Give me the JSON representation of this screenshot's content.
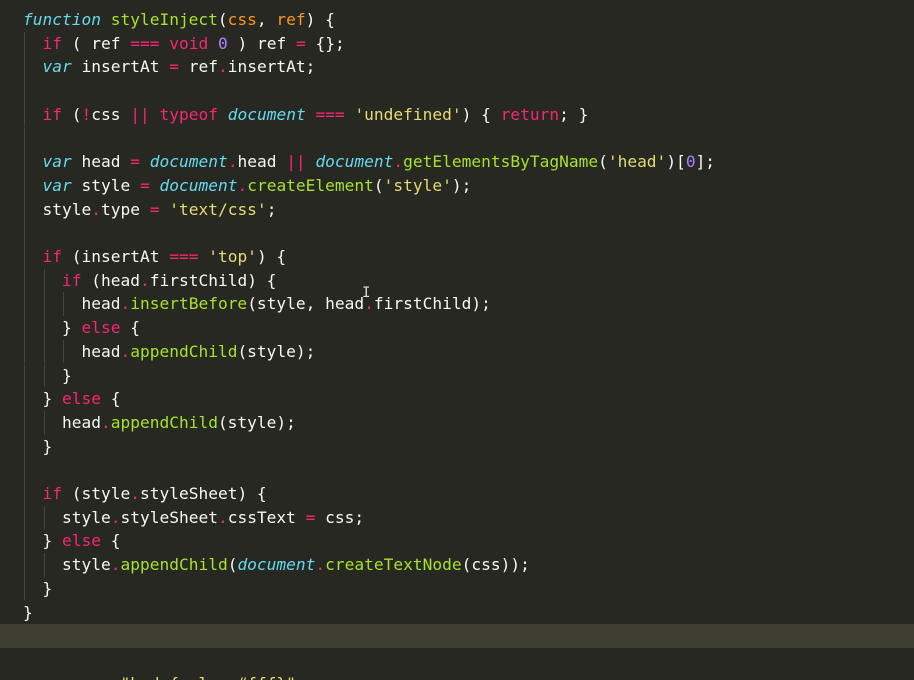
{
  "editor": {
    "language": "javascript",
    "theme": "monokai",
    "colors": {
      "background": "#272822",
      "keyword": "#f92672",
      "storage": "#66d9ef",
      "function": "#a6e22e",
      "parameter": "#fd971f",
      "number": "#ae81ff",
      "string": "#e6db74",
      "text": "#f8f8f2",
      "active_line": "#3e3d32"
    },
    "active_line_index": 26,
    "lines": [
      {
        "indent": 0,
        "tokens": [
          {
            "t": "store",
            "v": "function"
          },
          {
            "t": "plain",
            "v": " "
          },
          {
            "t": "fn",
            "v": "styleInject"
          },
          {
            "t": "plain",
            "v": "("
          },
          {
            "t": "param",
            "v": "css"
          },
          {
            "t": "plain",
            "v": ", "
          },
          {
            "t": "param",
            "v": "ref"
          },
          {
            "t": "plain",
            "v": ") {"
          }
        ]
      },
      {
        "indent": 1,
        "tokens": [
          {
            "t": "kw",
            "v": "if"
          },
          {
            "t": "plain",
            "v": " ( ref "
          },
          {
            "t": "op",
            "v": "==="
          },
          {
            "t": "plain",
            "v": " "
          },
          {
            "t": "kw",
            "v": "void"
          },
          {
            "t": "plain",
            "v": " "
          },
          {
            "t": "num",
            "v": "0"
          },
          {
            "t": "plain",
            "v": " ) ref "
          },
          {
            "t": "op",
            "v": "="
          },
          {
            "t": "plain",
            "v": " {};"
          }
        ]
      },
      {
        "indent": 1,
        "tokens": [
          {
            "t": "store",
            "v": "var"
          },
          {
            "t": "plain",
            "v": " insertAt "
          },
          {
            "t": "op",
            "v": "="
          },
          {
            "t": "plain",
            "v": " ref"
          },
          {
            "t": "op",
            "v": "."
          },
          {
            "t": "plain",
            "v": "insertAt;"
          }
        ]
      },
      {
        "indent": 1,
        "tokens": []
      },
      {
        "indent": 1,
        "tokens": [
          {
            "t": "kw",
            "v": "if"
          },
          {
            "t": "plain",
            "v": " ("
          },
          {
            "t": "op",
            "v": "!"
          },
          {
            "t": "plain",
            "v": "css "
          },
          {
            "t": "op",
            "v": "||"
          },
          {
            "t": "plain",
            "v": " "
          },
          {
            "t": "kw",
            "v": "typeof"
          },
          {
            "t": "plain",
            "v": " "
          },
          {
            "t": "store",
            "v": "document"
          },
          {
            "t": "plain",
            "v": " "
          },
          {
            "t": "op",
            "v": "==="
          },
          {
            "t": "plain",
            "v": " "
          },
          {
            "t": "str",
            "v": "'undefined'"
          },
          {
            "t": "plain",
            "v": ") { "
          },
          {
            "t": "kw",
            "v": "return"
          },
          {
            "t": "plain",
            "v": "; }"
          }
        ]
      },
      {
        "indent": 1,
        "tokens": []
      },
      {
        "indent": 1,
        "tokens": [
          {
            "t": "store",
            "v": "var"
          },
          {
            "t": "plain",
            "v": " head "
          },
          {
            "t": "op",
            "v": "="
          },
          {
            "t": "plain",
            "v": " "
          },
          {
            "t": "store",
            "v": "document"
          },
          {
            "t": "op",
            "v": "."
          },
          {
            "t": "plain",
            "v": "head "
          },
          {
            "t": "op",
            "v": "||"
          },
          {
            "t": "plain",
            "v": " "
          },
          {
            "t": "store",
            "v": "document"
          },
          {
            "t": "op",
            "v": "."
          },
          {
            "t": "fn",
            "v": "getElementsByTagName"
          },
          {
            "t": "plain",
            "v": "("
          },
          {
            "t": "str",
            "v": "'head'"
          },
          {
            "t": "plain",
            "v": ")["
          },
          {
            "t": "num",
            "v": "0"
          },
          {
            "t": "plain",
            "v": "];"
          }
        ]
      },
      {
        "indent": 1,
        "tokens": [
          {
            "t": "store",
            "v": "var"
          },
          {
            "t": "plain",
            "v": " style "
          },
          {
            "t": "op",
            "v": "="
          },
          {
            "t": "plain",
            "v": " "
          },
          {
            "t": "store",
            "v": "document"
          },
          {
            "t": "op",
            "v": "."
          },
          {
            "t": "fn",
            "v": "createElement"
          },
          {
            "t": "plain",
            "v": "("
          },
          {
            "t": "str",
            "v": "'style'"
          },
          {
            "t": "plain",
            "v": ");"
          }
        ]
      },
      {
        "indent": 1,
        "tokens": [
          {
            "t": "plain",
            "v": "style"
          },
          {
            "t": "op",
            "v": "."
          },
          {
            "t": "plain",
            "v": "type "
          },
          {
            "t": "op",
            "v": "="
          },
          {
            "t": "plain",
            "v": " "
          },
          {
            "t": "str",
            "v": "'text/css'"
          },
          {
            "t": "plain",
            "v": ";"
          }
        ]
      },
      {
        "indent": 1,
        "tokens": []
      },
      {
        "indent": 1,
        "tokens": [
          {
            "t": "kw",
            "v": "if"
          },
          {
            "t": "plain",
            "v": " (insertAt "
          },
          {
            "t": "op",
            "v": "==="
          },
          {
            "t": "plain",
            "v": " "
          },
          {
            "t": "str",
            "v": "'top'"
          },
          {
            "t": "plain",
            "v": ") {"
          }
        ]
      },
      {
        "indent": 2,
        "tokens": [
          {
            "t": "kw",
            "v": "if"
          },
          {
            "t": "plain",
            "v": " (head"
          },
          {
            "t": "op",
            "v": "."
          },
          {
            "t": "plain",
            "v": "firstChild) {"
          }
        ]
      },
      {
        "indent": 3,
        "tokens": [
          {
            "t": "plain",
            "v": "head"
          },
          {
            "t": "op",
            "v": "."
          },
          {
            "t": "fn",
            "v": "insertBefore"
          },
          {
            "t": "plain",
            "v": "(style, head"
          },
          {
            "t": "op",
            "v": "."
          },
          {
            "t": "plain",
            "v": "firstChild);"
          }
        ]
      },
      {
        "indent": 2,
        "tokens": [
          {
            "t": "plain",
            "v": "} "
          },
          {
            "t": "kw",
            "v": "else"
          },
          {
            "t": "plain",
            "v": " {"
          }
        ]
      },
      {
        "indent": 3,
        "tokens": [
          {
            "t": "plain",
            "v": "head"
          },
          {
            "t": "op",
            "v": "."
          },
          {
            "t": "fn",
            "v": "appendChild"
          },
          {
            "t": "plain",
            "v": "(style);"
          }
        ]
      },
      {
        "indent": 2,
        "tokens": [
          {
            "t": "plain",
            "v": "}"
          }
        ]
      },
      {
        "indent": 1,
        "tokens": [
          {
            "t": "plain",
            "v": "} "
          },
          {
            "t": "kw",
            "v": "else"
          },
          {
            "t": "plain",
            "v": " {"
          }
        ]
      },
      {
        "indent": 2,
        "tokens": [
          {
            "t": "plain",
            "v": "head"
          },
          {
            "t": "op",
            "v": "."
          },
          {
            "t": "fn",
            "v": "appendChild"
          },
          {
            "t": "plain",
            "v": "(style);"
          }
        ]
      },
      {
        "indent": 1,
        "tokens": [
          {
            "t": "plain",
            "v": "}"
          }
        ]
      },
      {
        "indent": 1,
        "tokens": []
      },
      {
        "indent": 1,
        "tokens": [
          {
            "t": "kw",
            "v": "if"
          },
          {
            "t": "plain",
            "v": " (style"
          },
          {
            "t": "op",
            "v": "."
          },
          {
            "t": "plain",
            "v": "styleSheet) {"
          }
        ]
      },
      {
        "indent": 2,
        "tokens": [
          {
            "t": "plain",
            "v": "style"
          },
          {
            "t": "op",
            "v": "."
          },
          {
            "t": "plain",
            "v": "styleSheet"
          },
          {
            "t": "op",
            "v": "."
          },
          {
            "t": "plain",
            "v": "cssText "
          },
          {
            "t": "op",
            "v": "="
          },
          {
            "t": "plain",
            "v": " css;"
          }
        ]
      },
      {
        "indent": 1,
        "tokens": [
          {
            "t": "plain",
            "v": "} "
          },
          {
            "t": "kw",
            "v": "else"
          },
          {
            "t": "plain",
            "v": " {"
          }
        ]
      },
      {
        "indent": 2,
        "tokens": [
          {
            "t": "plain",
            "v": "style"
          },
          {
            "t": "op",
            "v": "."
          },
          {
            "t": "fn",
            "v": "appendChild"
          },
          {
            "t": "plain",
            "v": "("
          },
          {
            "t": "store",
            "v": "document"
          },
          {
            "t": "op",
            "v": "."
          },
          {
            "t": "fn",
            "v": "createTextNode"
          },
          {
            "t": "plain",
            "v": "(css));"
          }
        ]
      },
      {
        "indent": 1,
        "tokens": [
          {
            "t": "plain",
            "v": "}"
          }
        ]
      },
      {
        "indent": 0,
        "tokens": [
          {
            "t": "plain",
            "v": "}"
          }
        ]
      },
      {
        "indent": 0,
        "tokens": []
      },
      {
        "indent": 0,
        "tokens": []
      },
      {
        "indent": 0,
        "tokens": [
          {
            "t": "store",
            "v": "var"
          },
          {
            "t": "plain",
            "v": " css "
          },
          {
            "t": "op",
            "v": "="
          },
          {
            "t": "plain",
            "v": " "
          },
          {
            "t": "str",
            "v": "\"body{color:#fff}\""
          },
          {
            "t": "plain",
            "v": ";"
          }
        ]
      }
    ],
    "cursor_glyph": "I"
  }
}
